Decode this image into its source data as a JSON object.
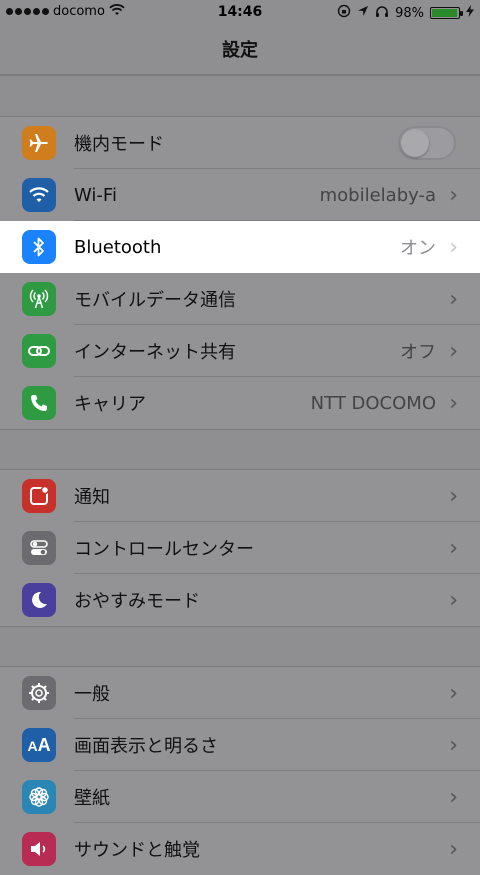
{
  "status": {
    "carrier": "docomo",
    "time": "14:46",
    "battery": "98%"
  },
  "nav": {
    "title": "設定"
  },
  "groups": [
    {
      "rows": [
        {
          "label": "機内モード",
          "value": "",
          "toggle": true,
          "toggle_on": false,
          "icon_color": "#d07d1e",
          "icon": "airplane-icon"
        },
        {
          "label": "Wi-Fi",
          "value": "mobilelaby-a",
          "icon_color": "#1f5fa8",
          "icon": "wifi-icon"
        },
        {
          "label": "Bluetooth",
          "value": "オン",
          "highlight": true,
          "icon_color": "#1a82fb",
          "icon": "bluetooth-icon"
        },
        {
          "label": "モバイルデータ通信",
          "value": "",
          "icon_color": "#2e9a41",
          "icon": "antenna-icon"
        },
        {
          "label": "インターネット共有",
          "value": "オフ",
          "icon_color": "#2e9a41",
          "icon": "link-icon"
        },
        {
          "label": "キャリア",
          "value": "NTT DOCOMO",
          "icon_color": "#2e9a41",
          "icon": "phone-icon"
        }
      ]
    },
    {
      "rows": [
        {
          "label": "通知",
          "value": "",
          "icon_color": "#c8302a",
          "icon": "notification-icon"
        },
        {
          "label": "コントロールセンター",
          "value": "",
          "icon_color": "#6b6b70",
          "icon": "toggles-icon"
        },
        {
          "label": "おやすみモード",
          "value": "",
          "icon_color": "#4a3f9c",
          "icon": "moon-icon"
        }
      ]
    },
    {
      "rows": [
        {
          "label": "一般",
          "value": "",
          "icon_color": "#6b6b70",
          "icon": "gear-icon"
        },
        {
          "label": "画面表示と明るさ",
          "value": "",
          "icon_color": "#1f5fa8",
          "icon": "text-size-icon"
        },
        {
          "label": "壁紙",
          "value": "",
          "icon_color": "#2a86b5",
          "icon": "flower-icon"
        },
        {
          "label": "サウンドと触覚",
          "value": "",
          "icon_color": "#b82b52",
          "icon": "speaker-icon"
        }
      ]
    }
  ]
}
